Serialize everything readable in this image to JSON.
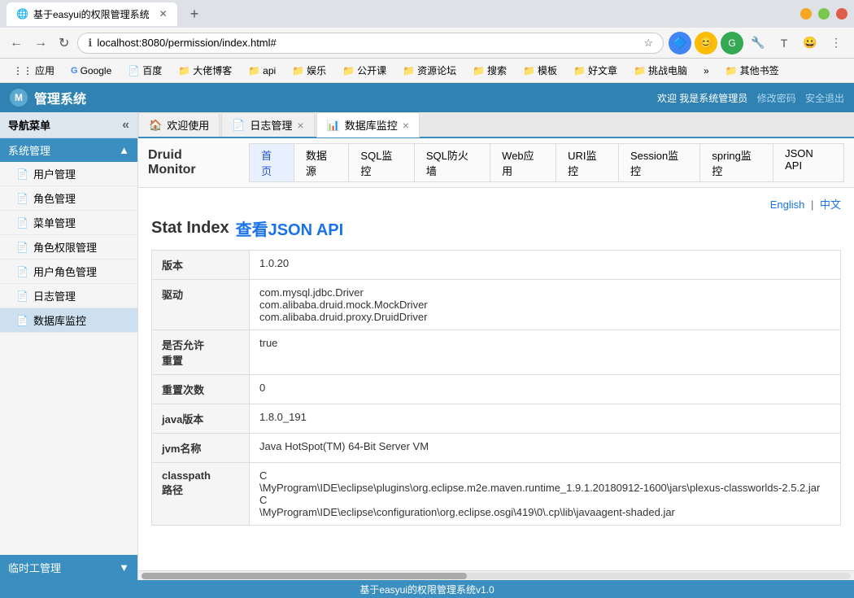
{
  "browser": {
    "tab_title": "基于easyui的权限管理系统",
    "tab_new": "+",
    "address": "localhost:8080/permission/index.html#",
    "back_btn": "←",
    "forward_btn": "→",
    "reload_btn": "↻",
    "win_min": "−",
    "win_max": "□",
    "win_close": "✕"
  },
  "bookmarks": [
    {
      "label": "应用",
      "icon": "🔷"
    },
    {
      "label": "Google",
      "icon": "G"
    },
    {
      "label": "百度",
      "icon": "📄"
    },
    {
      "label": "大佬博客",
      "icon": "📁"
    },
    {
      "label": "api",
      "icon": "📁"
    },
    {
      "label": "娱乐",
      "icon": "📁"
    },
    {
      "label": "公开课",
      "icon": "📁"
    },
    {
      "label": "资源论坛",
      "icon": "📁"
    },
    {
      "label": "搜索",
      "icon": "📁"
    },
    {
      "label": "模板",
      "icon": "📁"
    },
    {
      "label": "好文章",
      "icon": "📁"
    },
    {
      "label": "挑战电脑",
      "icon": "📁"
    },
    {
      "label": "»",
      "icon": ""
    },
    {
      "label": "其他书签",
      "icon": "📁"
    }
  ],
  "app": {
    "header": {
      "logo_text": "管理系统",
      "welcome": "欢迎 我是系统管理员",
      "modify_pwd": "修改密码",
      "safe_exit": "安全退出"
    },
    "footer": "基于easyui的权限管理系统v1.0"
  },
  "sidebar": {
    "title": "导航菜单",
    "sections": [
      {
        "label": "系统管理",
        "items": [
          {
            "label": "用户管理",
            "icon": "📄"
          },
          {
            "label": "角色管理",
            "icon": "📄"
          },
          {
            "label": "菜单管理",
            "icon": "📄"
          },
          {
            "label": "角色权限管理",
            "icon": "📄"
          },
          {
            "label": "用户角色管理",
            "icon": "📄"
          },
          {
            "label": "日志管理",
            "icon": "📄"
          },
          {
            "label": "数据库监控",
            "icon": "📄",
            "active": true
          }
        ]
      }
    ],
    "bottom_section": "临时工管理"
  },
  "tabs": [
    {
      "label": "欢迎使用",
      "closeable": false,
      "icon": "🏠"
    },
    {
      "label": "日志管理",
      "closeable": true,
      "icon": "📄"
    },
    {
      "label": "数据库监控",
      "closeable": true,
      "icon": "📊",
      "active": true
    }
  ],
  "druid": {
    "title": "Druid Monitor",
    "nav_items": [
      {
        "label": "首页",
        "active": true
      },
      {
        "label": "数据源"
      },
      {
        "label": "SQL监控"
      },
      {
        "label": "SQL防火墙"
      },
      {
        "label": "Web应用"
      },
      {
        "label": "URI监控"
      },
      {
        "label": "Session监控"
      },
      {
        "label": "spring监控"
      },
      {
        "label": "JSON API"
      }
    ],
    "lang_switch": {
      "english": "English",
      "sep": "|",
      "chinese": "中文"
    },
    "stat_title": "Stat Index",
    "stat_json_link": "查看JSON API",
    "table_rows": [
      {
        "key": "版本",
        "value": "1.0.20"
      },
      {
        "key": "驱动",
        "value": "com.mysql.jdbc.Driver\ncom.alibaba.druid.mock.MockDriver\ncom.alibaba.druid.proxy.DruidDriver"
      },
      {
        "key": "是否允许重置",
        "value": "true"
      },
      {
        "key": "重置次数",
        "value": "0"
      },
      {
        "key": "java版本",
        "value": "1.8.0_191"
      },
      {
        "key": "jvm名称",
        "value": "Java HotSpot(TM) 64-Bit Server VM"
      },
      {
        "key": "classpath路径",
        "value": "C\n\\MyProgram\\IDE\\eclipse\\plugins\\org.eclipse.m2e.maven.runtime_1.9.1.20180912-1600\\jars\\plexus-classworlds-2.5.2.jar\nC\n\\MyProgram\\IDE\\eclipse\\configuration\\org.eclipse.osgi\\419\\0\\.cp\\lib\\javaagent-shaded.jar"
      }
    ]
  }
}
